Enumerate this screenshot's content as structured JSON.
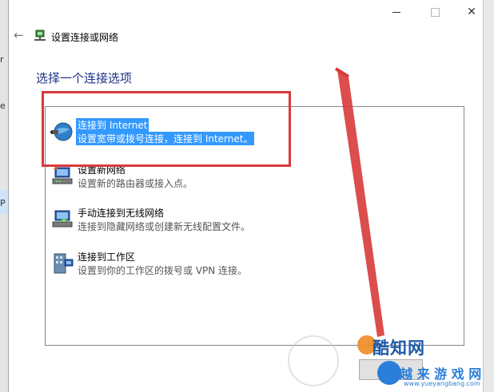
{
  "window": {
    "title": "设置连接或网络",
    "heading": "选择一个连接选项",
    "controls": {
      "minimize": "minimize-icon",
      "maximize": "maximize-icon",
      "close": "✕"
    }
  },
  "options": [
    {
      "title": "连接到 Internet",
      "desc": "设置宽带或拨号连接，连接到 Internet。",
      "icon": "globe-icon",
      "selected": true
    },
    {
      "title": "设置新网络",
      "desc": "设置新的路由器或接入点。",
      "icon": "router-icon",
      "selected": false
    },
    {
      "title": "手动连接到无线网络",
      "desc": "连接到隐藏网络或创建新无线配置文件。",
      "icon": "wireless-icon",
      "selected": false
    },
    {
      "title": "连接到工作区",
      "desc": "设置到你的工作区的拨号或 VPN 连接。",
      "icon": "vpn-icon",
      "selected": false
    }
  ],
  "background_fragments": [
    "r",
    "e",
    "P"
  ],
  "watermark": {
    "logo": "酷知网",
    "logo2": "越 来 游 戏 网",
    "url": "www.yueyangbang.com"
  },
  "colors": {
    "accent": "#3399ff",
    "heading": "#1e3287",
    "annotation_red": "#d83a3a"
  }
}
